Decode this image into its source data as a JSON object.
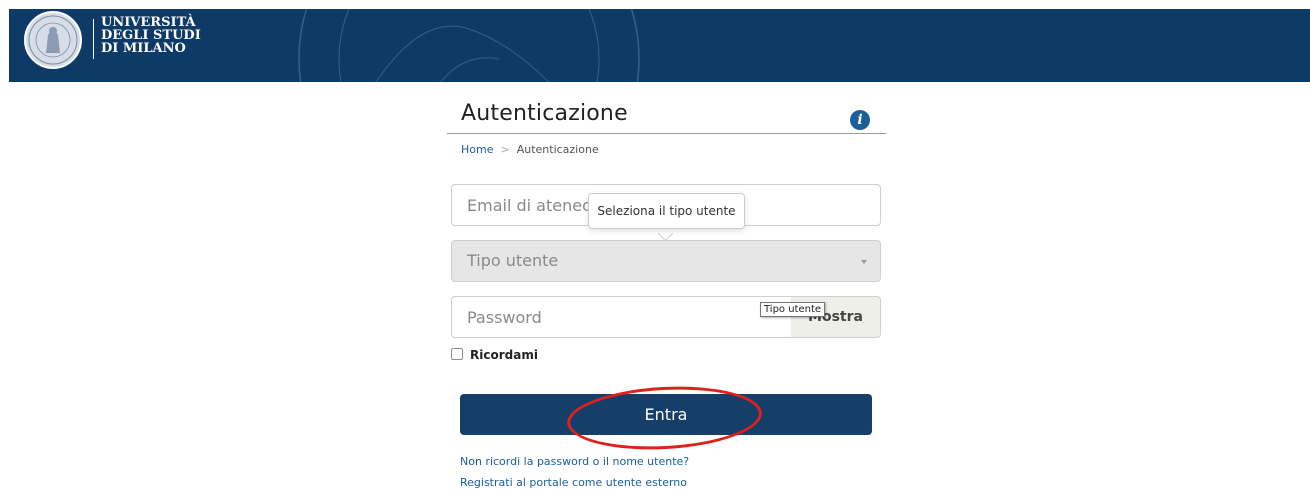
{
  "header": {
    "logo_lines": [
      "UNIVERSITÀ",
      "DEGLI STUDI",
      "DI MILANO"
    ],
    "background_color": "#0e3a68"
  },
  "page": {
    "title": "Autenticazione",
    "info_icon": "info-circle-icon"
  },
  "breadcrumb": {
    "home": "Home",
    "separator": ">",
    "current": "Autenticazione"
  },
  "form": {
    "email_placeholder": "Email di ateneo",
    "user_type_placeholder": "Tipo utente",
    "user_type_popover": "Seleziona il tipo utente",
    "password_placeholder": "Password",
    "show_button": "Mostra",
    "native_tooltip": "Tipo utente",
    "remember_label": "Ricordami",
    "submit_label": "Entra",
    "submit_color": "#153e68"
  },
  "links": {
    "forgot": "Non ricordi la password o il nome utente?",
    "register": "Registrati al portale come utente esterno"
  },
  "annotation": {
    "color": "#e0211b"
  }
}
